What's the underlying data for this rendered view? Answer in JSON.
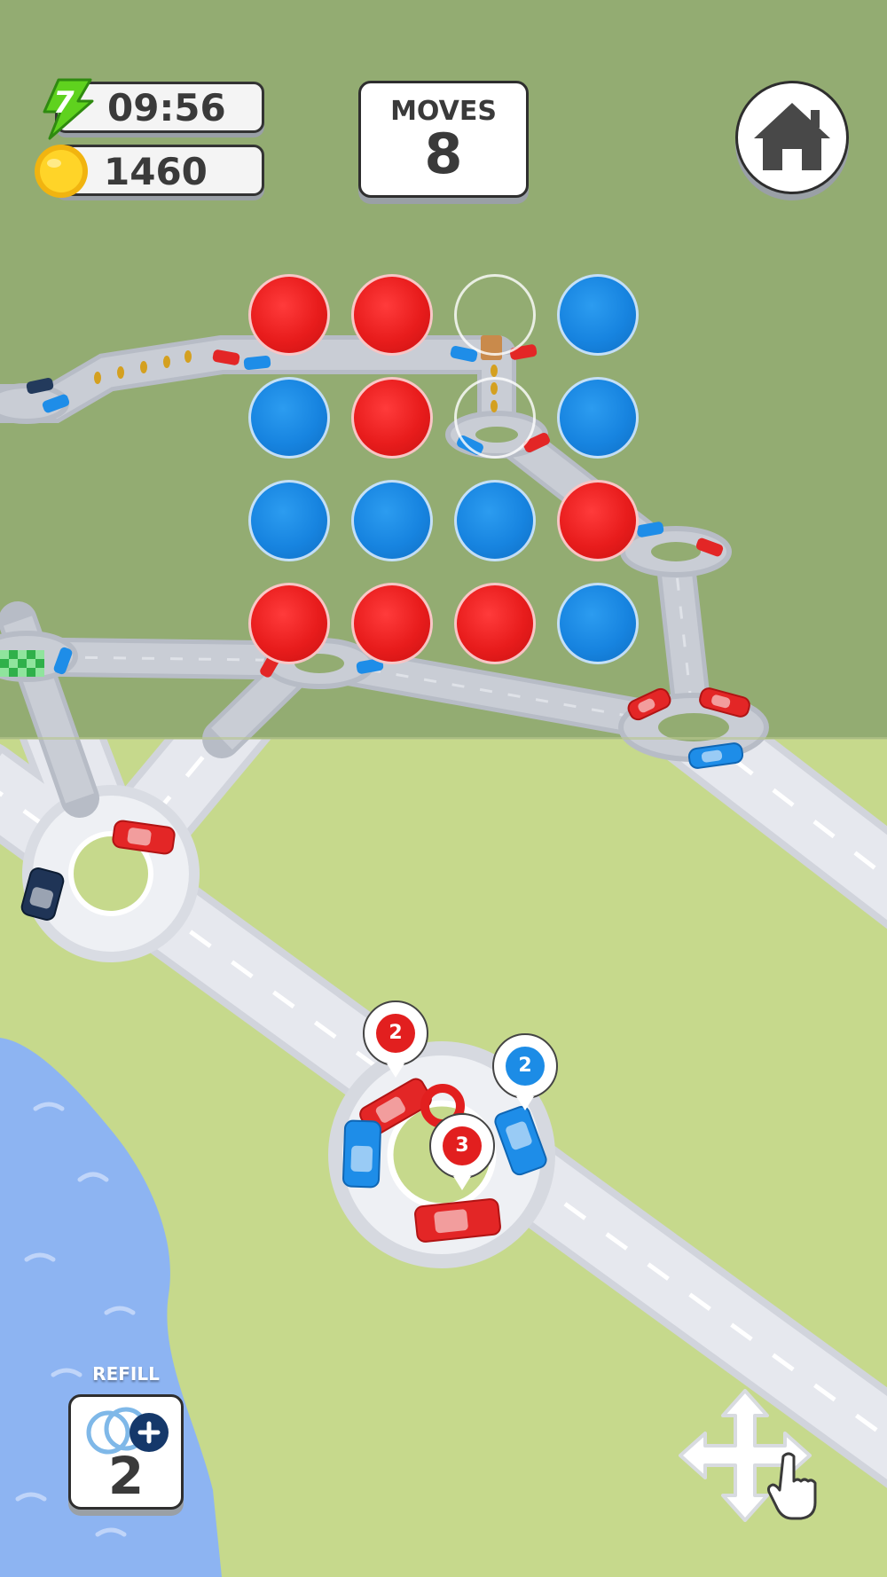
{
  "hud": {
    "level": "7",
    "timer": "09:56",
    "coins": "1460",
    "moves_label": "MOVES",
    "moves_value": "8"
  },
  "grid": {
    "rows": [
      [
        "red",
        "red",
        "empty",
        "blue"
      ],
      [
        "blue",
        "red",
        "empty",
        "blue"
      ],
      [
        "blue",
        "blue",
        "blue",
        "red"
      ],
      [
        "red",
        "red",
        "red",
        "blue"
      ]
    ]
  },
  "roundabout": {
    "pins": [
      {
        "count": "2",
        "color": "red"
      },
      {
        "count": "2",
        "color": "blue"
      },
      {
        "count": "3",
        "color": "red"
      }
    ]
  },
  "refill": {
    "label": "REFILL",
    "count": "2"
  },
  "colors": {
    "red": "#e81c1c",
    "blue": "#1784e0",
    "upper_ground": "#93ac72",
    "lower_ground": "#c6d98c",
    "water": "#8db4f2",
    "road": "#e4e6ec"
  },
  "icons": [
    "lightning-icon",
    "coin-icon",
    "home-icon",
    "refill-rings-icon",
    "plus-icon",
    "move-arrows-icon",
    "hand-pointer-icon"
  ]
}
